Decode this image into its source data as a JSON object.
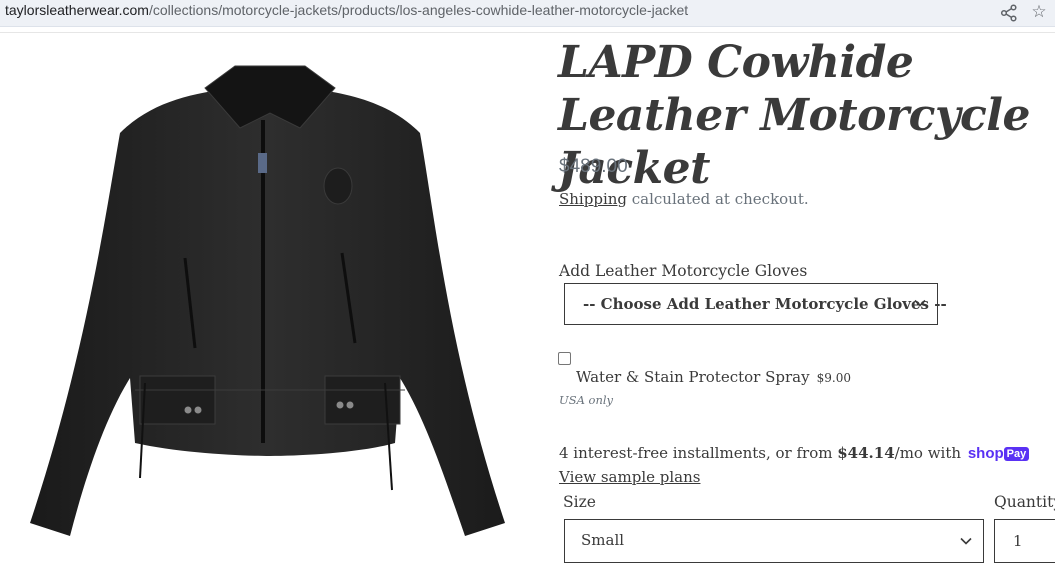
{
  "browser": {
    "url_domain": "taylorsleatherwear.com",
    "url_path": "/collections/motorcycle-jackets/products/los-angeles-cowhide-leather-motorcycle-jacket"
  },
  "product": {
    "title": "LAPD Cowhide Leather Motorcycle Jacket",
    "price": "$489.00",
    "shipping_link": "Shipping",
    "shipping_text": " calculated at checkout.",
    "image_alt": "black leather motorcycle jacket"
  },
  "gloves": {
    "label": "Add Leather Motorcycle Gloves",
    "selected": "-- Choose Add Leather Motorcycle Gloves --"
  },
  "spray": {
    "label": "Water & Stain Protector Spray",
    "price": "$9.00",
    "note": "USA only",
    "checked": false
  },
  "installments": {
    "prefix": "4 interest-free installments, or from ",
    "amount": "$44.14",
    "suffix": "/mo with ",
    "brand_shop": "shop",
    "brand_pay": "Pay",
    "brand_color": "#5a31f4",
    "view_plans": "View sample plans"
  },
  "size": {
    "label": "Size",
    "selected": "Small"
  },
  "quantity": {
    "label": "Quantity",
    "value": "1"
  }
}
